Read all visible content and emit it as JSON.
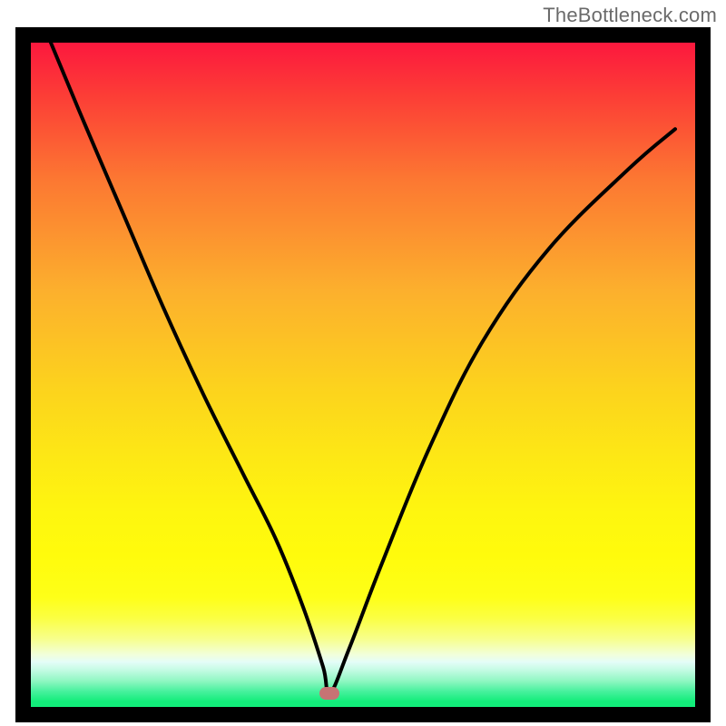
{
  "attribution": "TheBottleneck.com",
  "colors": {
    "frame": "#000000",
    "curve": "#000000",
    "marker": "#c77374"
  },
  "chart_data": {
    "type": "line",
    "title": "",
    "xlabel": "",
    "ylabel": "",
    "xlim": [
      0,
      100
    ],
    "ylim": [
      0,
      100
    ],
    "annotations": [
      {
        "kind": "marker",
        "x": 45,
        "y": 2,
        "note": "optimal-point"
      }
    ],
    "series": [
      {
        "name": "bottleneck-curve",
        "x": [
          3,
          8,
          14,
          20,
          26,
          32,
          37,
          41,
          44,
          45,
          48,
          53,
          60,
          68,
          78,
          90,
          97
        ],
        "y": [
          100,
          88,
          74,
          60,
          47,
          35,
          25,
          15,
          6,
          2,
          9,
          22,
          39,
          55,
          69,
          81,
          87
        ]
      }
    ],
    "gradient_stops": [
      {
        "pos": 0.0,
        "rgb": [
          252,
          23,
          62
        ]
      },
      {
        "pos": 0.02,
        "rgb": [
          252,
          23,
          62
        ]
      },
      {
        "pos": 0.1,
        "rgb": [
          252,
          62,
          54
        ]
      },
      {
        "pos": 0.22,
        "rgb": [
          252,
          120,
          50
        ]
      },
      {
        "pos": 0.38,
        "rgb": [
          252,
          176,
          45
        ]
      },
      {
        "pos": 0.52,
        "rgb": [
          252,
          211,
          29
        ]
      },
      {
        "pos": 0.62,
        "rgb": [
          253,
          232,
          21
        ]
      },
      {
        "pos": 0.7,
        "rgb": [
          254,
          246,
          15
        ]
      },
      {
        "pos": 0.76,
        "rgb": [
          255,
          251,
          12
        ]
      },
      {
        "pos": 0.82,
        "rgb": [
          254,
          255,
          24
        ]
      },
      {
        "pos": 0.85,
        "rgb": [
          251,
          255,
          67
        ]
      },
      {
        "pos": 0.88,
        "rgb": [
          247,
          255,
          140
        ]
      },
      {
        "pos": 0.903,
        "rgb": [
          241,
          255,
          220
        ]
      },
      {
        "pos": 0.913,
        "rgb": [
          228,
          253,
          248
        ]
      },
      {
        "pos": 0.925,
        "rgb": [
          195,
          251,
          227
        ]
      },
      {
        "pos": 0.94,
        "rgb": [
          145,
          247,
          195
        ]
      },
      {
        "pos": 0.955,
        "rgb": [
          73,
          241,
          158
        ]
      },
      {
        "pos": 0.97,
        "rgb": [
          18,
          237,
          122
        ]
      },
      {
        "pos": 1.0,
        "rgb": [
          18,
          237,
          122
        ]
      }
    ]
  },
  "geometry": {
    "frame_size": 766,
    "plot_inset": 17
  }
}
